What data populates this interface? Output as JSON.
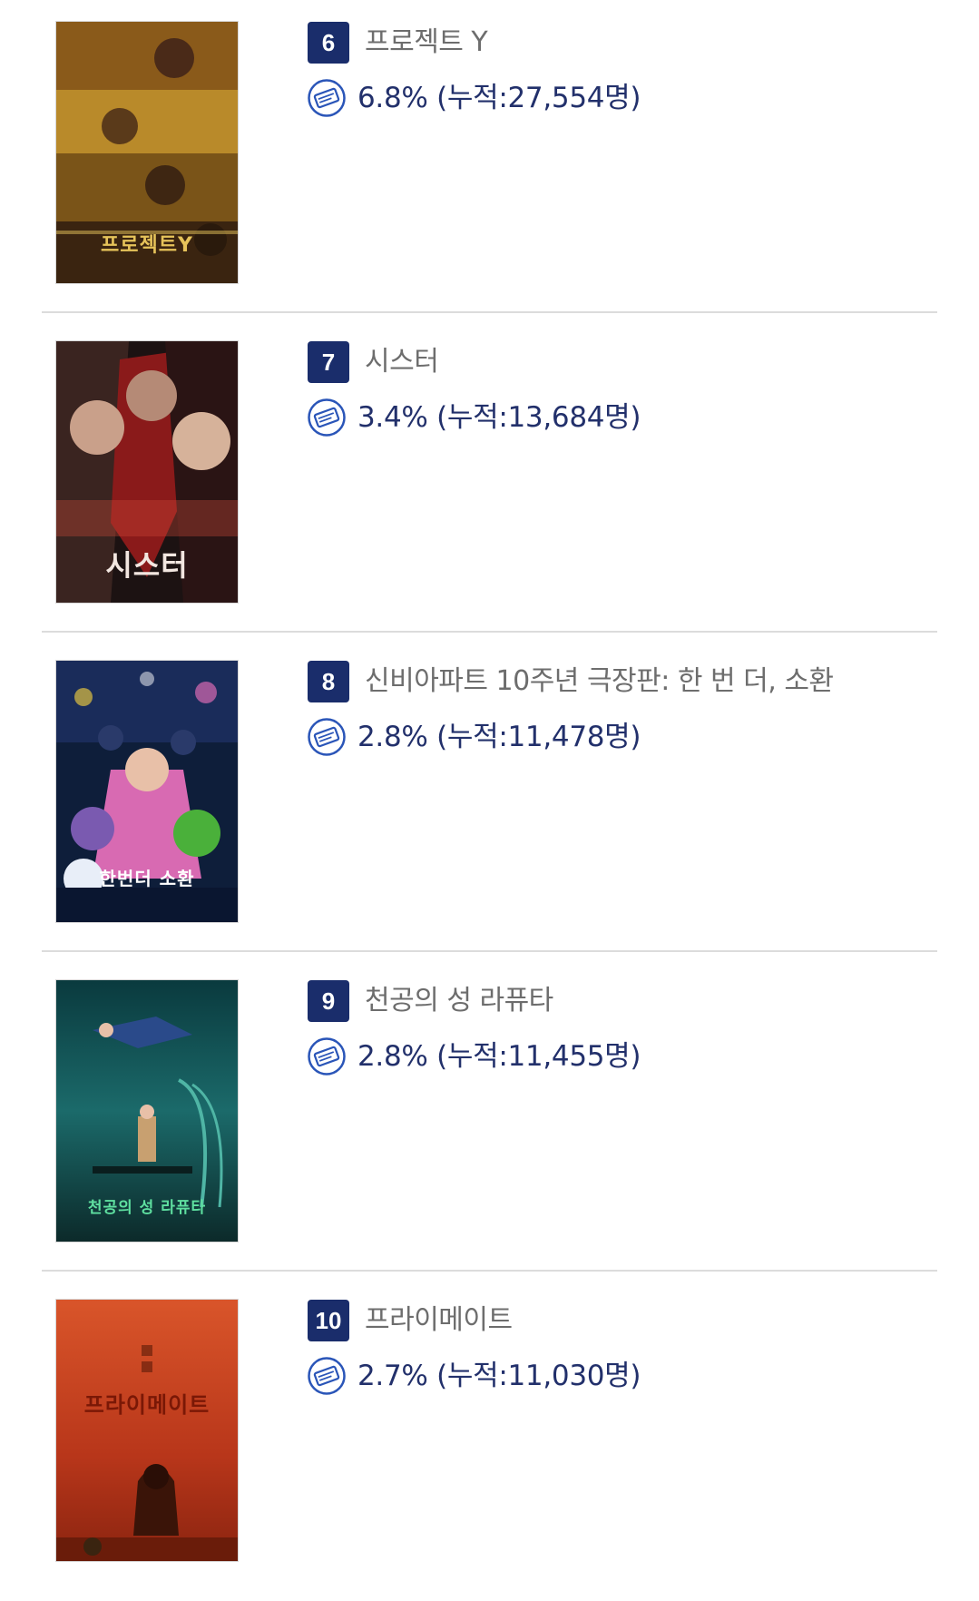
{
  "items": [
    {
      "rank": "6",
      "title": "프로젝트 Y",
      "share": "6.8%",
      "cumulative": "(누적:27,554명)",
      "poster_text": "프로젝트Y",
      "poster_colors": [
        "#2a1a0e",
        "#b98a2a",
        "#e6c35a",
        "#3a2410"
      ],
      "icon": "ticket-icon"
    },
    {
      "rank": "7",
      "title": "시스터",
      "share": "3.4%",
      "cumulative": "(누적:13,684명)",
      "poster_text": "시스터",
      "poster_colors": [
        "#1c1212",
        "#8a1a1a",
        "#d24a3a",
        "#2a1414"
      ],
      "icon": "ticket-icon"
    },
    {
      "rank": "8",
      "title": "신비아파트 10주년 극장판: 한 번 더, 소환",
      "share": "2.8%",
      "cumulative": "(누적:11,478명)",
      "poster_text": "한번더 소환",
      "poster_colors": [
        "#0e1e3a",
        "#3a4f8a",
        "#d86ab2",
        "#4ab03a"
      ],
      "icon": "ticket-icon"
    },
    {
      "rank": "9",
      "title": "천공의 성 라퓨타",
      "share": "2.8%",
      "cumulative": "(누적:11,455명)",
      "poster_text": "천공의 성 라퓨타",
      "poster_colors": [
        "#0a3a3e",
        "#1b6a6a",
        "#4fb5a5",
        "#0c2a2a"
      ],
      "icon": "ticket-icon"
    },
    {
      "rank": "10",
      "title": "프라이메이트",
      "share": "2.7%",
      "cumulative": "(누적:11,030명)",
      "poster_text": "프라이메이트",
      "poster_colors": [
        "#b8361a",
        "#d9552a",
        "#8a2410",
        "#2a120a"
      ],
      "icon": "ticket-icon"
    }
  ],
  "colors": {
    "badge": "#1a2d6b",
    "stat_text": "#22306b",
    "title_text": "#6d6d6d",
    "divider": "#dcdcdc"
  }
}
